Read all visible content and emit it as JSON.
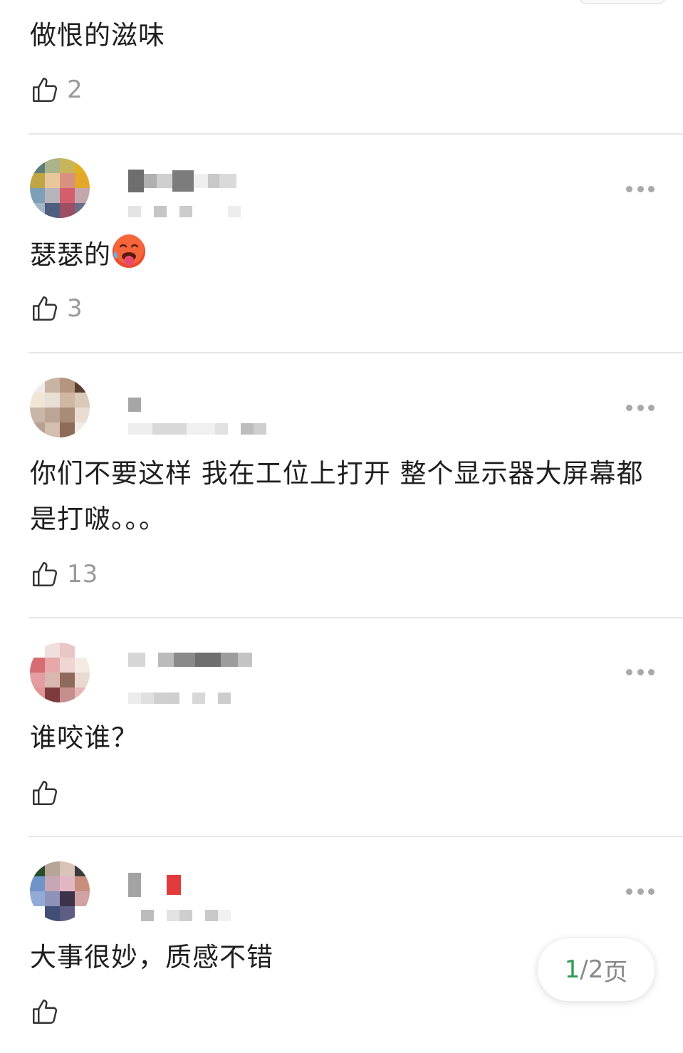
{
  "comments": [
    {
      "text": "做恨的滋味",
      "likes": "2"
    },
    {
      "text": "瑟瑟的",
      "emoji": "hot-face-emoji",
      "likes": "3"
    },
    {
      "text": "你们不要这样 我在工位上打开 整个显示器大屏幕都是打啵。。。",
      "likes": "13"
    },
    {
      "text": "谁咬谁？",
      "likes": ""
    },
    {
      "text": "大事很妙，质感不错",
      "likes": ""
    }
  ],
  "pagination": {
    "current": "1",
    "separator": "/",
    "total": "2",
    "unit": "页"
  },
  "icons": {
    "like": "thumb-up-outline-icon",
    "more": "more-dots-icon"
  },
  "colors": {
    "accent": "#2e9b55",
    "muted": "#9a9a9a",
    "divider": "#e6e6e6"
  }
}
